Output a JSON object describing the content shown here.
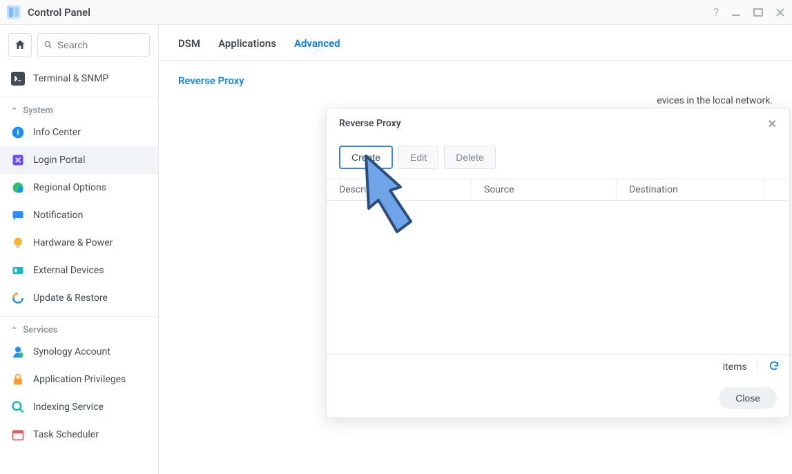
{
  "window": {
    "title": "Control Panel"
  },
  "sidebar": {
    "search_placeholder": "Search",
    "top_items": [
      {
        "id": "terminal-snmp",
        "label": "Terminal & SNMP"
      }
    ],
    "sections": [
      {
        "heading": "System",
        "items": [
          {
            "id": "info-center",
            "label": "Info Center",
            "icon": "info-icon",
            "color": "#1d8eff"
          },
          {
            "id": "login-portal",
            "label": "Login Portal",
            "icon": "portal-icon",
            "color": "#6b4cff",
            "active": true
          },
          {
            "id": "regional-options",
            "label": "Regional Options",
            "icon": "globe-icon",
            "color": "#2fbf71"
          },
          {
            "id": "notification",
            "label": "Notification",
            "icon": "chat-icon",
            "color": "#2b8eff"
          },
          {
            "id": "hardware-power",
            "label": "Hardware & Power",
            "icon": "bulb-icon",
            "color": "#ffb02e"
          },
          {
            "id": "external-devices",
            "label": "External Devices",
            "icon": "devices-icon",
            "color": "#19b8c4"
          },
          {
            "id": "update-restore",
            "label": "Update & Restore",
            "icon": "refresh-icon",
            "color": "#1d8eff"
          }
        ]
      },
      {
        "heading": "Services",
        "items": [
          {
            "id": "synology-account",
            "label": "Synology Account",
            "icon": "person-icon",
            "color": "#1d8eff"
          },
          {
            "id": "application-privileges",
            "label": "Application Privileges",
            "icon": "lock-icon",
            "color": "#ff9a2e"
          },
          {
            "id": "indexing-service",
            "label": "Indexing Service",
            "icon": "magnifier-icon",
            "color": "#19b8c4"
          },
          {
            "id": "task-scheduler",
            "label": "Task Scheduler",
            "icon": "calendar-icon",
            "color": "#e05b5b"
          }
        ]
      }
    ]
  },
  "tabs": {
    "items": [
      "DSM",
      "Applications",
      "Advanced"
    ],
    "active": "Advanced"
  },
  "section": {
    "title": "Reverse Proxy",
    "description_visible": "evices in the local network."
  },
  "modal": {
    "title": "Reverse Proxy",
    "buttons": {
      "create": "Create",
      "edit": "Edit",
      "delete": "Delete"
    },
    "columns": [
      "Description",
      "Source",
      "Destination"
    ],
    "status_items": "items",
    "close_label": "Close"
  }
}
